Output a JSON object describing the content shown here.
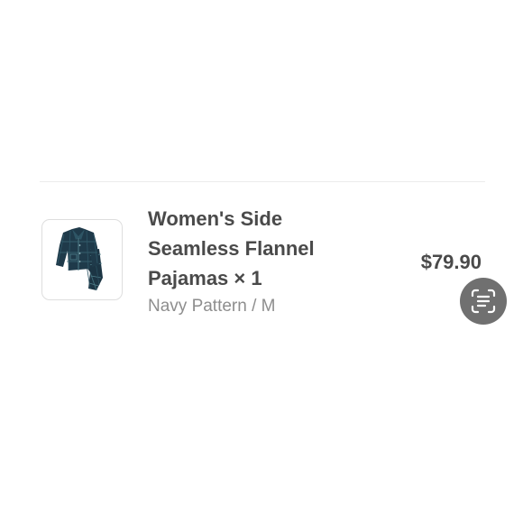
{
  "item": {
    "title": "Women's Side Seamless Flannel Pajamas × 1",
    "variant": "Navy Pattern / M",
    "price": "$79.90",
    "image_icon": "pajamas-product-image"
  },
  "actions": {
    "scan_icon": "scan-text-icon"
  },
  "colors": {
    "text_primary": "#4a4a4a",
    "text_secondary": "#8e8e8e",
    "fabric": "#1f3a4a",
    "scan_button": "#707070"
  }
}
